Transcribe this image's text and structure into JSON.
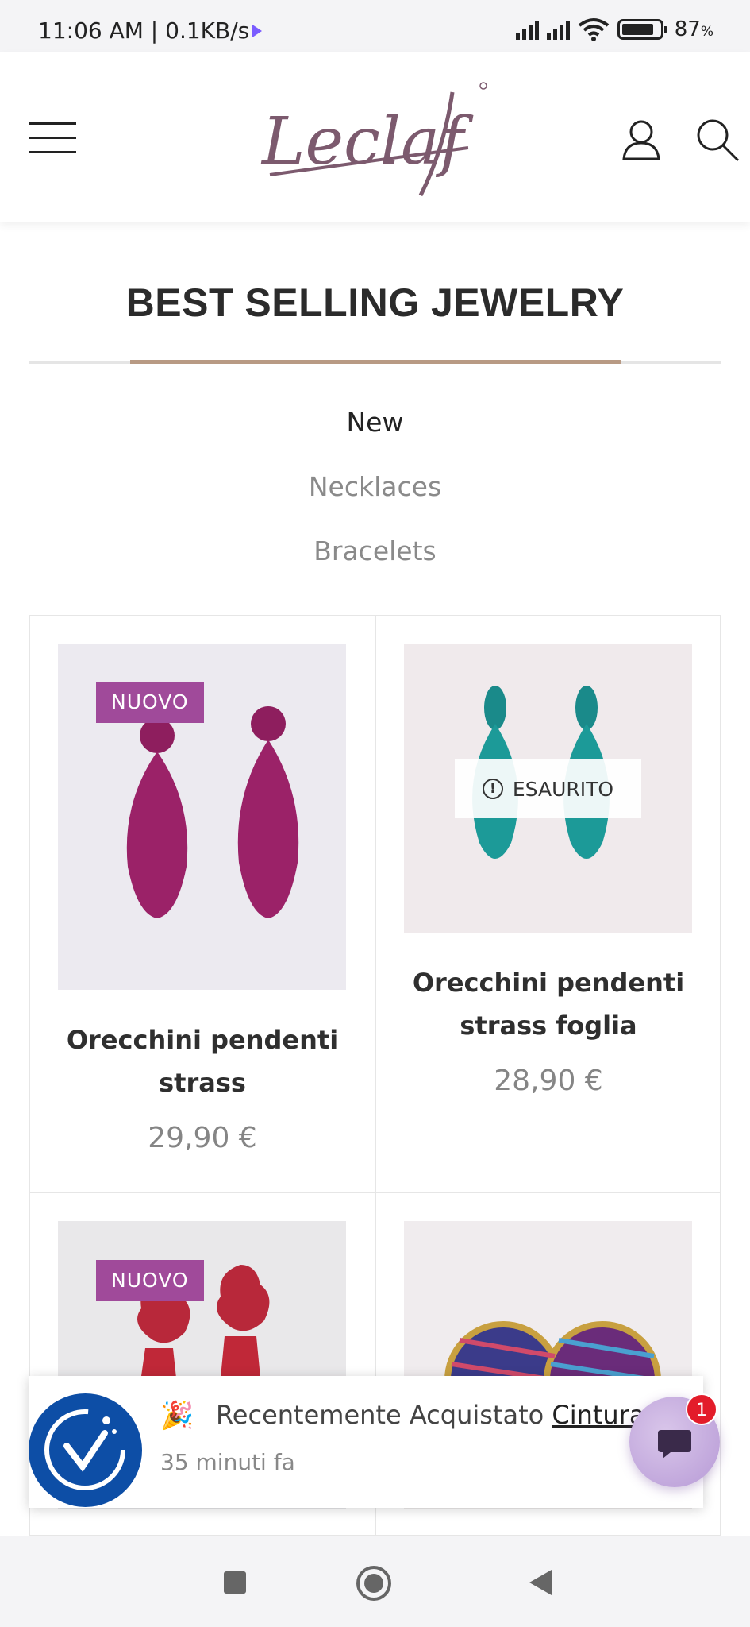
{
  "status_bar": {
    "time": "11:06 AM | 0.1KB/s",
    "battery": "87",
    "battery_unit": "%"
  },
  "header": {
    "logo_text": "Leclaf",
    "icons": [
      "hamburger-menu-icon",
      "user-icon",
      "search-icon"
    ]
  },
  "section": {
    "title": "BEST SELLING JEWELRY"
  },
  "tabs": [
    {
      "label": "New",
      "active": true
    },
    {
      "label": "Necklaces",
      "active": false
    },
    {
      "label": "Bracelets",
      "active": false
    }
  ],
  "products": [
    {
      "name_line1": "Orecchini pendenti",
      "name_line2": "strass",
      "price": "29,90 €",
      "badge": "NUOVO"
    },
    {
      "name_line1": "Orecchini pendenti",
      "name_line2": "strass foglia",
      "price": "28,90 €",
      "status": "ESAURITO"
    },
    {
      "badge": "NUOVO"
    },
    {}
  ],
  "notification": {
    "emoji": "🎉",
    "text": "Recentemente Acquistato",
    "link": "Cintura",
    "time": "35 minuti fa"
  },
  "chat": {
    "badge_count": "1"
  },
  "colors": {
    "accent_line": "#b89a84",
    "badge_purple": "#a04a9a",
    "notify_logo_blue": "#0d4ea6",
    "chat_badge_red": "#e31c2a"
  }
}
